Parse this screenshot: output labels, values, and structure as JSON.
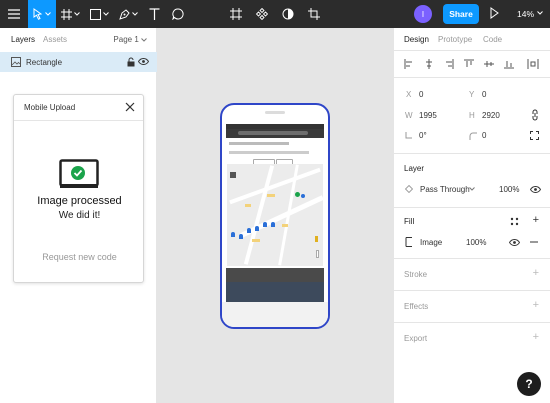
{
  "toolbar": {
    "user_initial": "I",
    "share_label": "Share",
    "zoom_label": "14%"
  },
  "left_panel": {
    "tab_layers": "Layers",
    "tab_assets": "Assets",
    "page_label": "Page 1",
    "layers": [
      {
        "name": "Rectangle"
      }
    ]
  },
  "mobile_upload": {
    "title": "Mobile Upload",
    "status_title": "Image processed",
    "status_subtitle": "We did it!",
    "request_label": "Request new code"
  },
  "right_panel": {
    "tab_design": "Design",
    "tab_prototype": "Prototype",
    "tab_code": "Code",
    "x_label": "X",
    "x_value": "0",
    "y_label": "Y",
    "y_value": "0",
    "w_label": "W",
    "w_value": "1995",
    "h_label": "H",
    "h_value": "2920",
    "rotation_value": "0°",
    "radius_value": "0",
    "layer_section": "Layer",
    "blend_mode": "Pass Through",
    "layer_opacity": "100%",
    "fill_section": "Fill",
    "fill_type": "Image",
    "fill_opacity": "100%",
    "stroke_section": "Stroke",
    "effects_section": "Effects",
    "export_section": "Export"
  },
  "help_label": "?",
  "colors": {
    "toolbar_bg": "#2c2c2c",
    "accent": "#0d99ff",
    "avatar": "#7b61ff",
    "selection_bg": "#daebf7",
    "phone_frame": "#2f46c8",
    "success": "#1aa34a"
  }
}
